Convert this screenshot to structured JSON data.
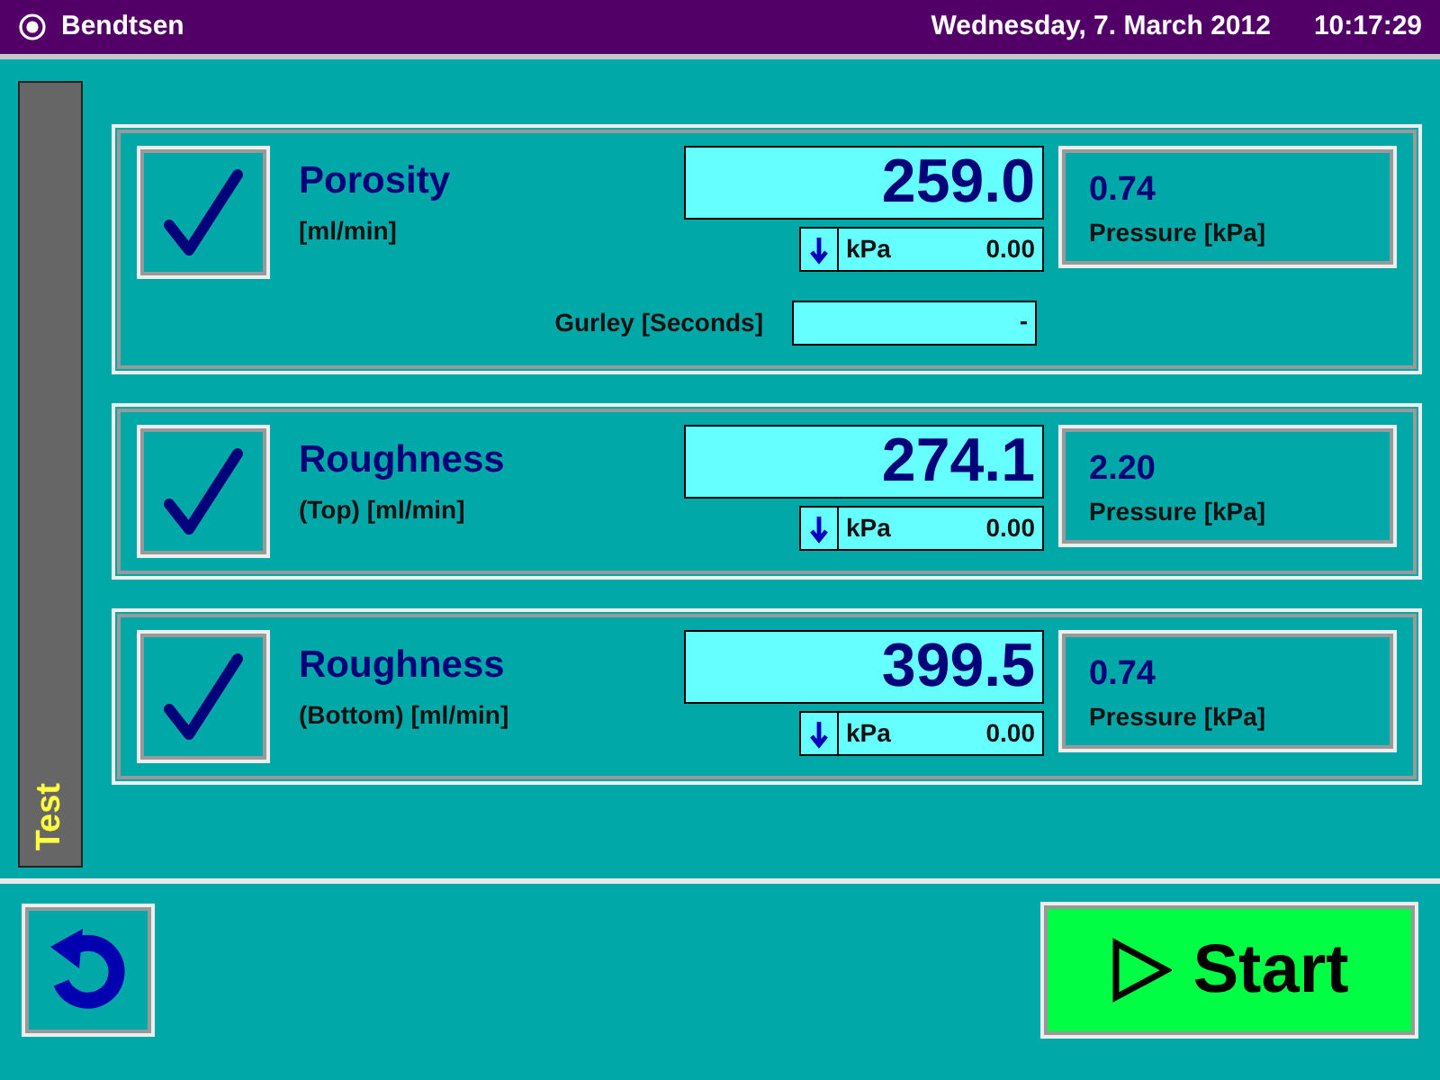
{
  "title_bar": {
    "app_title": "Bendtsen",
    "date": "Wednesday, 7. March 2012",
    "time": "10:17:29"
  },
  "side_tab": {
    "label": "Test"
  },
  "measurements": [
    {
      "checked": true,
      "name": "Porosity",
      "unit": "[ml/min]",
      "value": "259.0",
      "flow_unit": "kPa",
      "flow_value": "0.00",
      "pressure_value": "0.74",
      "pressure_label": "Pressure [kPa]",
      "gurley": {
        "label": "Gurley [Seconds]",
        "value": "-"
      }
    },
    {
      "checked": true,
      "name": "Roughness",
      "unit": "(Top) [ml/min]",
      "value": "274.1",
      "flow_unit": "kPa",
      "flow_value": "0.00",
      "pressure_value": "2.20",
      "pressure_label": "Pressure [kPa]"
    },
    {
      "checked": true,
      "name": "Roughness",
      "unit": "(Bottom) [ml/min]",
      "value": "399.5",
      "flow_unit": "kPa",
      "flow_value": "0.00",
      "pressure_value": "0.74",
      "pressure_label": "Pressure [kPa]"
    }
  ],
  "buttons": {
    "start": "Start"
  }
}
